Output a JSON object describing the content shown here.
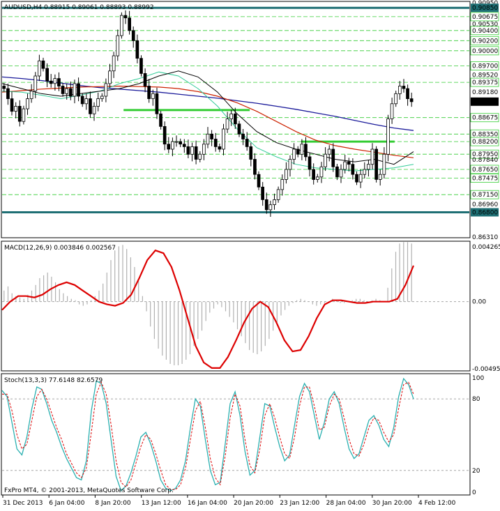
{
  "window": {
    "symbol_line": "AUDUSD,H4  0.88915 0.89061 0.88893 0.88992",
    "copyright": "FxPro MT4, © 2001-2013, MetaQuotes Software Corp."
  },
  "colors": {
    "background": "#ffffff",
    "candle": "#000000",
    "hline_teal": "#1e6f74",
    "hline_green": "#33cc33",
    "fib_dash": "#33cc33",
    "ma_blue": "#1a1a9a",
    "ma_red": "#cc2200",
    "ma_black": "#000000",
    "ma_teal": "#33cc99",
    "macd_line": "#dd0000",
    "macd_hist": "#b0b0b0",
    "stoch_main": "#2ab0b0",
    "stoch_signal": "#dd0000"
  },
  "chart_data": [
    {
      "type": "candlestick",
      "title": "AUDUSD,H4  0.88915 0.89061 0.88893 0.88992",
      "ylim": [
        0.8631,
        0.9095
      ],
      "price_scale_labels": [
        "0.90950",
        "0.90850",
        "0.90675",
        "0.90530",
        "0.90400",
        "0.90200",
        "0.90000",
        "0.89700",
        "0.89520",
        "0.89375",
        "0.89180",
        "0.88992",
        "0.88675",
        "0.88350",
        "0.88200",
        "0.87950",
        "0.87840",
        "0.87650",
        "0.87475",
        "0.87150",
        "0.86960",
        "0.86800",
        "0.86310"
      ],
      "current_price": 0.88992,
      "horizontal_levels": [
        {
          "price": 0.9085,
          "style": "teal-thick"
        },
        {
          "price": 0.868,
          "style": "teal-thick"
        },
        {
          "price": 0.88825,
          "style": "green",
          "from": 0.26,
          "to": 0.53
        },
        {
          "price": 0.882,
          "style": "green",
          "from": 0.64,
          "to": 0.84
        }
      ],
      "fib_levels": [
        0.90675,
        0.904,
        0.902,
        0.9,
        0.897,
        0.89375,
        0.88675,
        0.8835,
        0.882,
        0.8795,
        0.8765,
        0.87475,
        0.8715,
        0.868
      ],
      "closes": [
        0.8925,
        0.8905,
        0.888,
        0.889,
        0.886,
        0.8885,
        0.8905,
        0.892,
        0.895,
        0.898,
        0.8965,
        0.894,
        0.8935,
        0.8945,
        0.893,
        0.8915,
        0.8925,
        0.891,
        0.8935,
        0.891,
        0.8895,
        0.8905,
        0.8875,
        0.889,
        0.8905,
        0.891,
        0.8935,
        0.896,
        0.899,
        0.903,
        0.907,
        0.9065,
        0.904,
        0.902,
        0.8985,
        0.8955,
        0.893,
        0.8905,
        0.8915,
        0.8875,
        0.885,
        0.8815,
        0.8805,
        0.882,
        0.882,
        0.8815,
        0.881,
        0.8795,
        0.881,
        0.8785,
        0.8795,
        0.8815,
        0.8835,
        0.8825,
        0.881,
        0.8805,
        0.8845,
        0.8865,
        0.8875,
        0.8855,
        0.8835,
        0.8825,
        0.881,
        0.8785,
        0.8755,
        0.873,
        0.8705,
        0.8685,
        0.8695,
        0.8705,
        0.8725,
        0.8745,
        0.8765,
        0.8785,
        0.8805,
        0.8795,
        0.8815,
        0.879,
        0.8765,
        0.8745,
        0.875,
        0.877,
        0.8795,
        0.8805,
        0.877,
        0.875,
        0.8765,
        0.878,
        0.8775,
        0.8755,
        0.874,
        0.8755,
        0.8765,
        0.8775,
        0.8805,
        0.8745,
        0.8755,
        0.8795,
        0.8865,
        0.8895,
        0.8915,
        0.893,
        0.8925,
        0.8905,
        0.8899
      ],
      "ma_blue": [
        0.8948,
        0.8945,
        0.8941,
        0.8936,
        0.8931,
        0.8927,
        0.8924,
        0.8921,
        0.8918,
        0.8914,
        0.891,
        0.8906,
        0.8901,
        0.8896,
        0.889,
        0.8884,
        0.8877,
        0.887,
        0.8862,
        0.8854,
        0.8847,
        0.8842
      ],
      "ma_red": [
        0.8918,
        0.8921,
        0.8924,
        0.8926,
        0.8928,
        0.8929,
        0.893,
        0.8929,
        0.8928,
        0.8925,
        0.8919,
        0.891,
        0.8897,
        0.888,
        0.886,
        0.884,
        0.8823,
        0.8812,
        0.8805,
        0.8799,
        0.8793,
        0.8788
      ],
      "ma_black": [
        0.8935,
        0.8925,
        0.8915,
        0.891,
        0.8915,
        0.892,
        0.8925,
        0.8935,
        0.895,
        0.896,
        0.8948,
        0.8918,
        0.8875,
        0.884,
        0.8818,
        0.8805,
        0.8795,
        0.8785,
        0.878,
        0.8785,
        0.8775,
        0.88
      ],
      "ma_teal": [
        0.892,
        0.8918,
        0.8912,
        0.8905,
        0.8912,
        0.892,
        0.8935,
        0.8945,
        0.8958,
        0.895,
        0.8925,
        0.889,
        0.8845,
        0.8808,
        0.879,
        0.8775,
        0.8768,
        0.8765,
        0.8762,
        0.8765,
        0.8768,
        0.8775
      ]
    },
    {
      "type": "macd",
      "title": "MACD(12,26,9) 0.003846 0.002567",
      "ylim": [
        -0.004955,
        0.004265
      ],
      "scale_labels": [
        "0.004265",
        "0.00",
        "-0.004955"
      ],
      "histogram": [
        0.0008,
        0.0011,
        0.0006,
        0.0004,
        0.0003,
        0.0002,
        0.0005,
        0.0008,
        0.0012,
        0.0017,
        0.0019,
        0.0021,
        0.0018,
        0.0014,
        0.0009,
        0.0006,
        0.0004,
        0.0002,
        0.0001,
        -0.0002,
        -0.0003,
        -0.0002,
        0.0001,
        0.0004,
        0.0008,
        0.0013,
        0.0021,
        0.003,
        0.0037,
        0.004,
        0.0041,
        0.0038,
        0.0032,
        0.0025,
        0.0015,
        0.0004,
        -0.0007,
        -0.0018,
        -0.0027,
        -0.0034,
        -0.0039,
        -0.0042,
        -0.0045,
        -0.0046,
        -0.0046,
        -0.0045,
        -0.0042,
        -0.0038,
        -0.0032,
        -0.0027,
        -0.0021,
        -0.0014,
        -0.0008,
        -0.0005,
        -0.0002,
        -0.0004,
        -0.0007,
        -0.0011,
        -0.0015,
        -0.002,
        -0.0025,
        -0.003,
        -0.0035,
        -0.0037,
        -0.0038,
        -0.0036,
        -0.0032,
        -0.0027,
        -0.0021,
        -0.0015,
        -0.001,
        -0.0006,
        -0.0003,
        -0.0001,
        0.0001,
        0.0002,
        0.0001,
        0.0,
        -0.0002,
        -0.0003,
        -0.0002,
        -0.0001,
        0.0,
        0.0002,
        0.0001,
        -0.0001,
        -0.0001,
        0.0,
        0.0001,
        0.0002,
        0.0002,
        0.0001,
        0.0,
        0.0001,
        0.0002,
        0.0001,
        0.0,
        0.001,
        0.0024,
        0.0036,
        0.0042,
        0.0043,
        0.0043,
        0.0042
      ],
      "signal": [
        -0.0006,
        0.0,
        0.0004,
        0.0004,
        0.0003,
        0.0005,
        0.0009,
        0.0012,
        0.0014,
        0.0012,
        0.0008,
        0.0004,
        0.0,
        -0.0002,
        -0.0003,
        -0.0001,
        0.0005,
        0.0017,
        0.003,
        0.0037,
        0.0035,
        0.0025,
        0.0008,
        -0.0012,
        -0.0032,
        -0.0044,
        -0.0048,
        -0.0048,
        -0.004,
        -0.0028,
        -0.0015,
        -0.0005,
        0.0,
        -0.0004,
        -0.0015,
        -0.0028,
        -0.0036,
        -0.0035,
        -0.0025,
        -0.0012,
        -0.0002,
        0.0001,
        0.0001,
        0.0,
        -0.0001,
        -0.0001,
        0.0,
        0.0,
        0.0,
        0.0002,
        0.0012,
        0.0026
      ]
    },
    {
      "type": "stochastic",
      "title": "Stoch(13,3,3) 77.6148 82.6579",
      "ylim": [
        0,
        100
      ],
      "scale_labels": [
        "100",
        "80",
        "20",
        "0"
      ],
      "main": [
        87,
        82,
        60,
        38,
        33,
        48,
        72,
        90,
        88,
        76,
        62,
        52,
        40,
        30,
        22,
        14,
        12,
        28,
        70,
        95,
        93,
        76,
        45,
        15,
        3,
        7,
        18,
        32,
        48,
        52,
        42,
        28,
        12,
        5,
        3,
        5,
        12,
        28,
        56,
        80,
        74,
        46,
        20,
        8,
        10,
        42,
        76,
        86,
        66,
        36,
        16,
        20,
        48,
        76,
        74,
        56,
        40,
        28,
        33,
        58,
        82,
        93,
        86,
        66,
        46,
        60,
        80,
        86,
        76,
        56,
        38,
        30,
        34,
        48,
        62,
        66,
        58,
        46,
        40,
        56,
        82,
        97,
        92,
        80
      ],
      "signal": [
        84,
        84,
        70,
        50,
        38,
        42,
        62,
        82,
        88,
        80,
        68,
        56,
        46,
        34,
        26,
        18,
        14,
        22,
        52,
        84,
        94,
        84,
        58,
        28,
        10,
        6,
        12,
        26,
        40,
        50,
        46,
        34,
        20,
        8,
        4,
        4,
        8,
        22,
        46,
        70,
        78,
        56,
        30,
        14,
        8,
        32,
        64,
        84,
        74,
        46,
        24,
        18,
        38,
        66,
        76,
        64,
        48,
        34,
        30,
        48,
        74,
        90,
        90,
        74,
        54,
        56,
        74,
        84,
        80,
        64,
        46,
        34,
        32,
        42,
        56,
        64,
        62,
        52,
        44,
        50,
        72,
        92,
        94,
        84
      ]
    }
  ],
  "time_axis": {
    "labels": [
      "31 Dec 2013",
      "6 Jan 04:00",
      "8 Jan 20:00",
      "13 Jan 12:00",
      "16 Jan 04:00",
      "20 Jan 20:00",
      "23 Jan 12:00",
      "28 Jan 04:00",
      "30 Jan 20:00",
      "4 Feb 12:00"
    ]
  }
}
